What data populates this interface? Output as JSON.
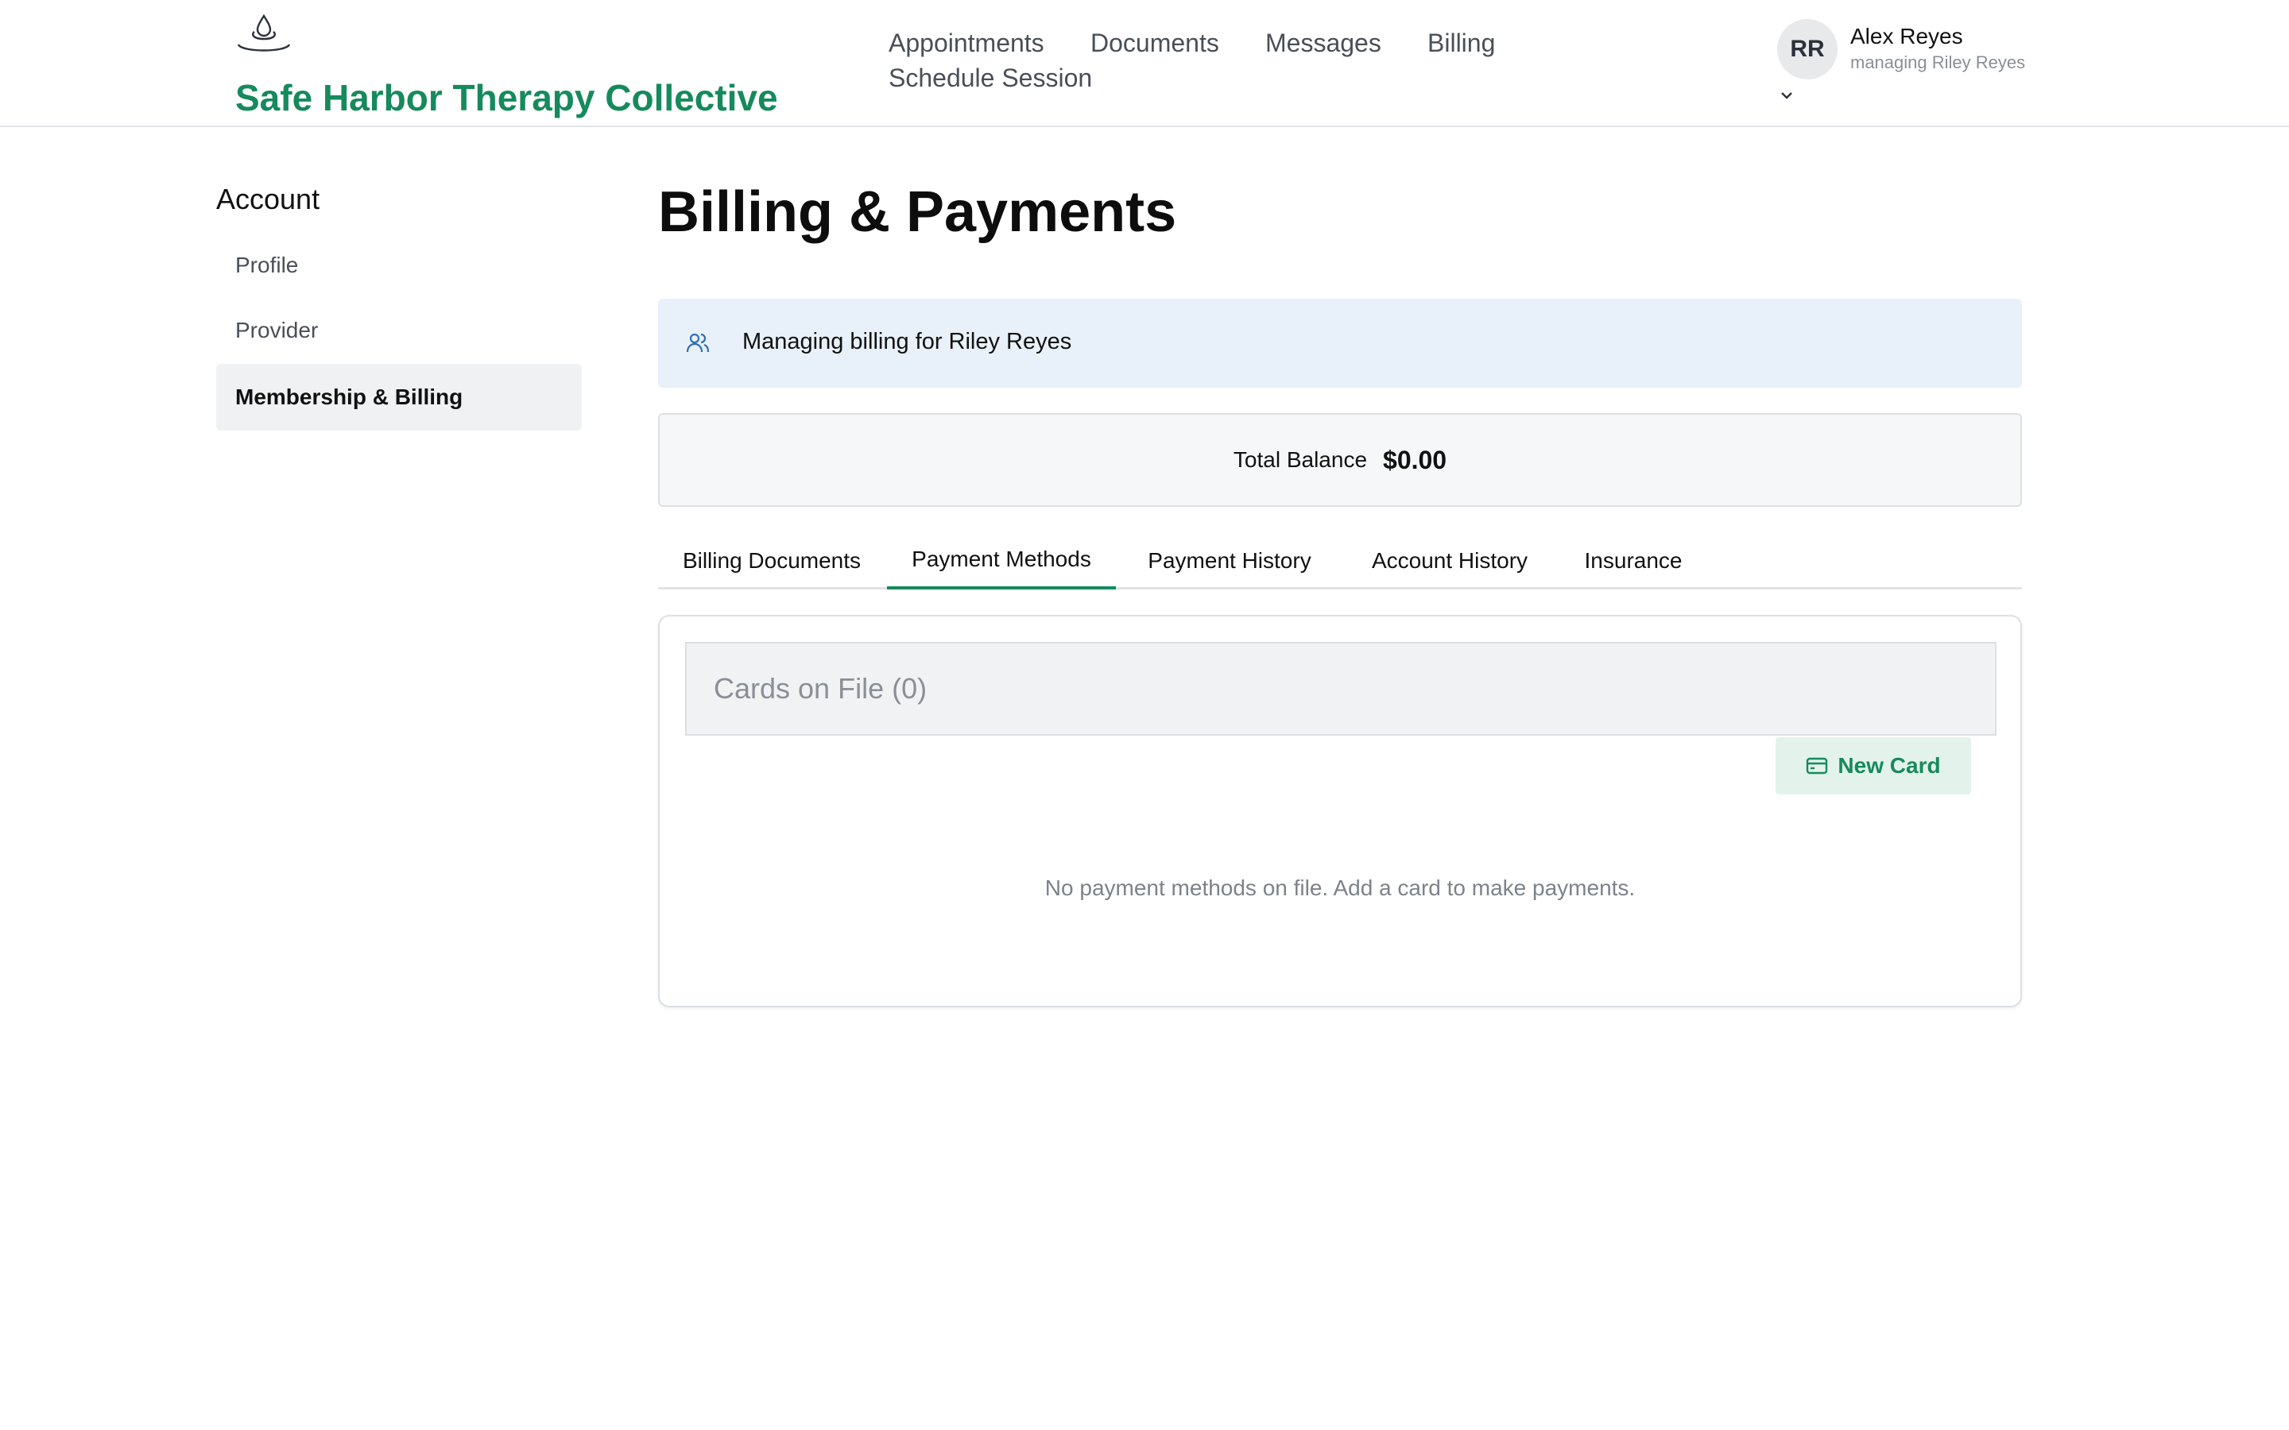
{
  "header": {
    "brand": "Safe Harbor Therapy Collective",
    "logo_icon": "water-drop-ripple-icon",
    "nav": [
      "Appointments",
      "Documents",
      "Messages",
      "Billing",
      "Schedule Session"
    ],
    "user": {
      "initials": "RR",
      "name": "Alex Reyes",
      "subtitle": "managing Riley Reyes"
    }
  },
  "sidebar": {
    "title": "Account",
    "items": [
      {
        "label": "Profile",
        "active": false
      },
      {
        "label": "Provider",
        "active": false
      },
      {
        "label": "Membership & Billing",
        "active": true
      }
    ]
  },
  "main": {
    "title": "Billing & Payments",
    "banner": {
      "icon": "users-icon",
      "text": "Managing billing for Riley Reyes"
    },
    "balance": {
      "label": "Total Balance",
      "value": "$0.00"
    },
    "tabs": [
      {
        "label": "Billing Documents",
        "active": false
      },
      {
        "label": "Payment Methods",
        "active": true
      },
      {
        "label": "Payment History",
        "active": false
      },
      {
        "label": "Account History",
        "active": false
      },
      {
        "label": "Insurance",
        "active": false
      }
    ],
    "cards": {
      "title": "Cards on File (0)",
      "new_card_label": "New Card",
      "new_card_icon": "credit-card-icon",
      "empty_message": "No payment methods on file. Add a card to make payments."
    }
  },
  "colors": {
    "brand": "#168a5d",
    "banner_bg": "#e8f0f9",
    "button_bg": "#e3f3ec"
  }
}
